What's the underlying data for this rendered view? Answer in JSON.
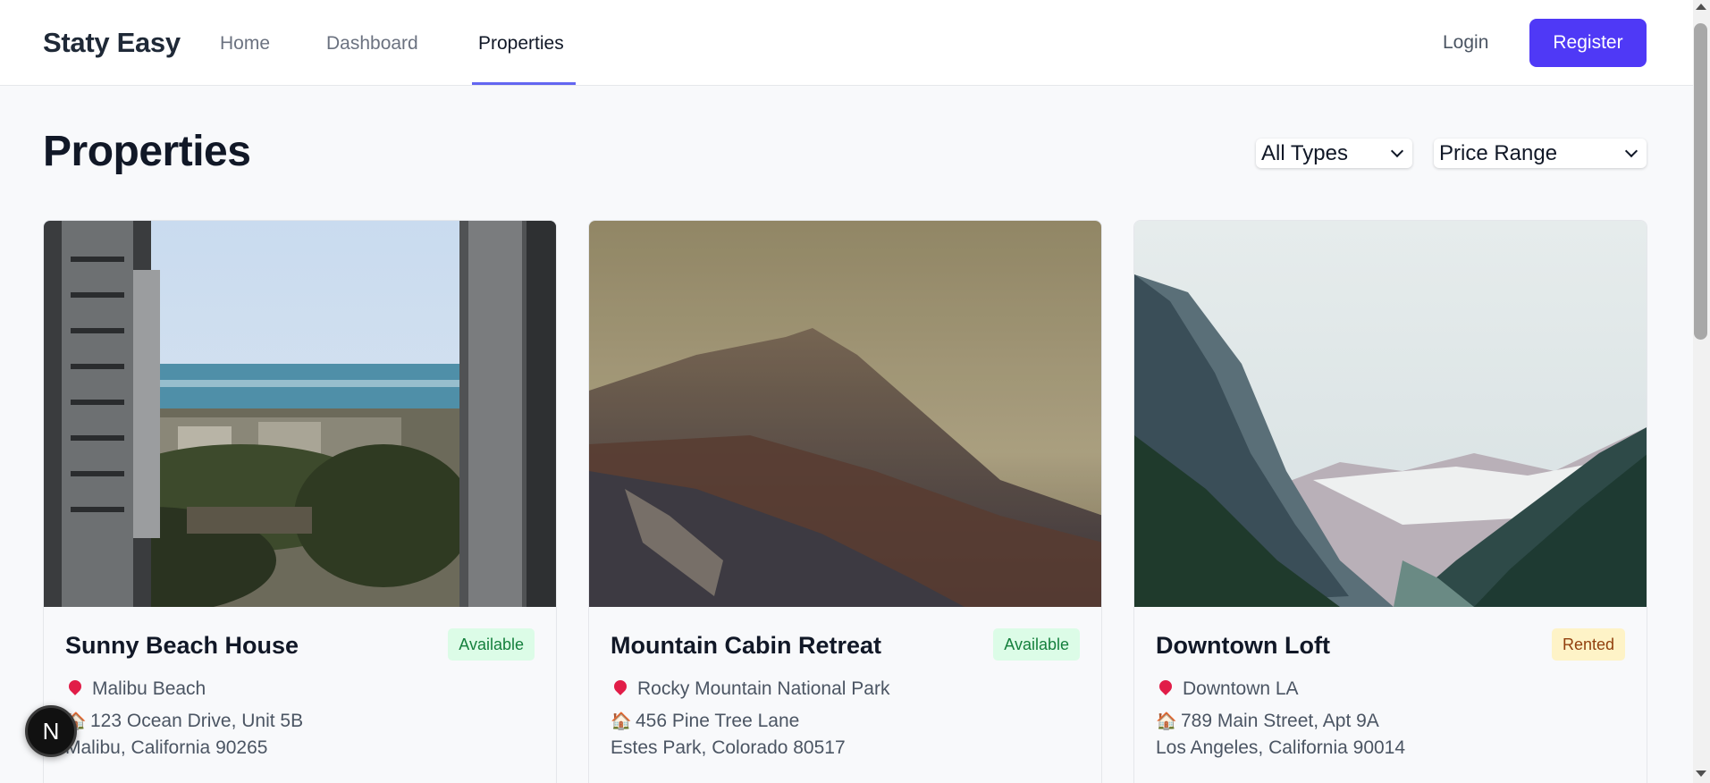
{
  "header": {
    "brand": "Staty Easy",
    "nav": [
      {
        "label": "Home"
      },
      {
        "label": "Dashboard"
      },
      {
        "label": "Properties",
        "active": true
      }
    ],
    "login_label": "Login",
    "register_label": "Register",
    "accent_color": "#4f39f6"
  },
  "main": {
    "title": "Properties",
    "filters": {
      "type_select": "All Types",
      "price_select": "Price Range"
    },
    "properties": [
      {
        "title": "Sunny Beach House",
        "status": "Available",
        "location": "Malibu Beach",
        "address": "123 Ocean Drive, Unit 5B",
        "city": "Malibu, California 90265",
        "image": "beach-buildings-photo"
      },
      {
        "title": "Mountain Cabin Retreat",
        "status": "Available",
        "location": "Rocky Mountain National Park",
        "address": "456 Pine Tree Lane",
        "city": "Estes Park, Colorado 80517",
        "image": "foggy-mountain-photo"
      },
      {
        "title": "Downtown Loft",
        "status": "Rented",
        "location": "Downtown LA",
        "address": "789 Main Street, Apt 9A",
        "city": "Los Angeles, California 90014",
        "image": "mountain-valley-photo"
      }
    ]
  },
  "floating": {
    "badge_letter": "N"
  },
  "colors": {
    "available_bg": "#dcfce7",
    "available_text": "#15803d",
    "rented_bg": "#fef3c7",
    "rented_text": "#92400e"
  }
}
